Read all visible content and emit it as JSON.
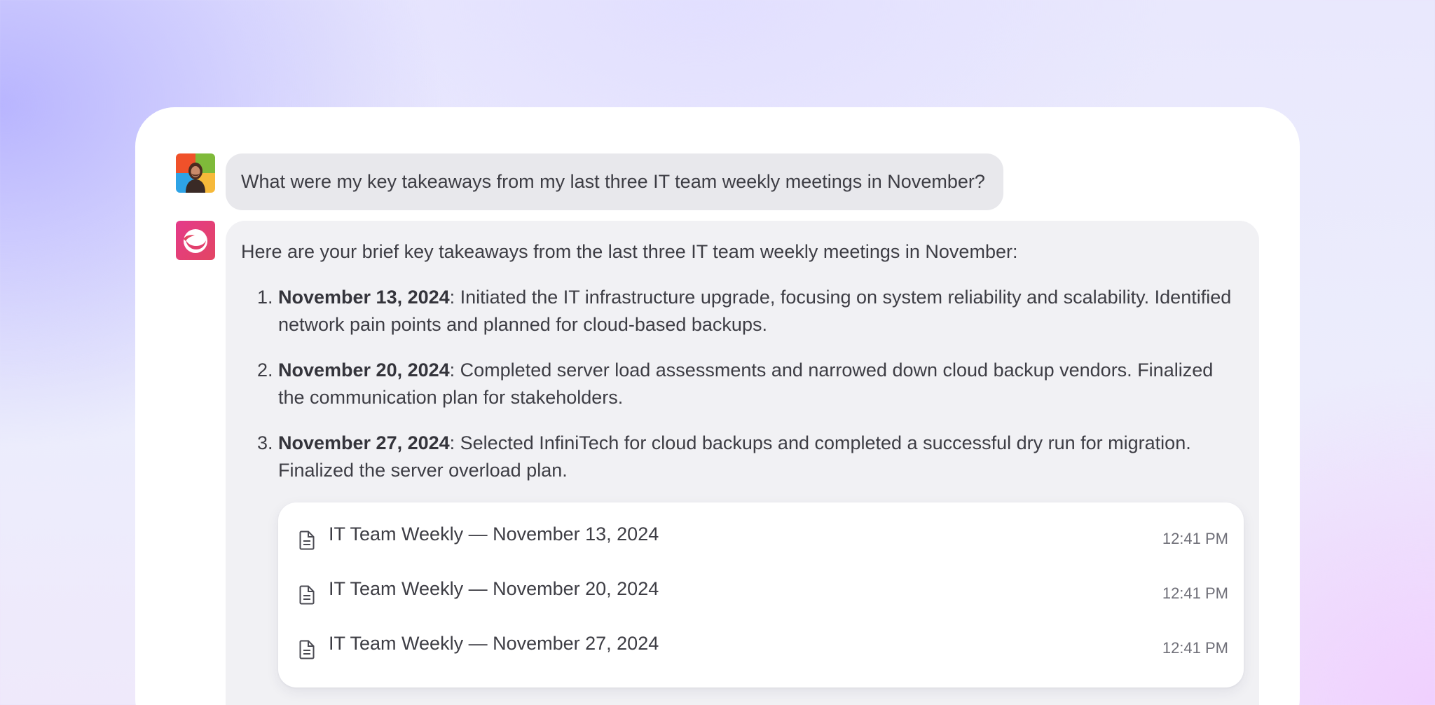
{
  "conversation": {
    "user_message": "What were my key takeaways from my last three IT team weekly meetings in November?",
    "assistant_intro": "Here are your brief key takeaways from the last three IT team weekly meetings in November:",
    "takeaways": [
      {
        "date": "November 13, 2024",
        "text": ": Initiated the IT infrastructure upgrade, focusing on system reliability and scalability. Identified network pain points and planned for cloud-based backups."
      },
      {
        "date": "November 20, 2024",
        "text": ": Completed server load assessments and narrowed down cloud backup vendors. Finalized the communication plan for stakeholders."
      },
      {
        "date": "November 27, 2024",
        "text": ": Selected InfiniTech for cloud backups and completed a successful dry run for migration. Finalized the server overload plan."
      }
    ],
    "sources": [
      {
        "icon": "document-icon",
        "title": "IT Team Weekly — November 13, 2024",
        "time": "12:41 PM"
      },
      {
        "icon": "document-icon",
        "title": "IT Team Weekly — November 20, 2024",
        "time": "12:41 PM"
      },
      {
        "icon": "document-icon",
        "title": "IT Team Weekly — November 27, 2024",
        "time": "12:41 PM"
      }
    ]
  },
  "avatars": {
    "user": "user-avatar",
    "assistant": "assistant-logo-icon"
  },
  "colors": {
    "assistant_brand": "#e43a6f",
    "user_bubble": "#e8e8ec",
    "assistant_bubble": "#f1f1f4"
  }
}
